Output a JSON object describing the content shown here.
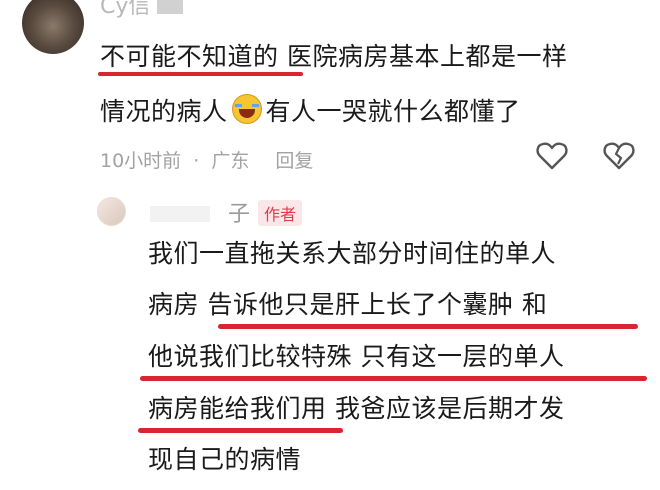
{
  "comment": {
    "username": "Cy信",
    "line1": "不可能不知道的 医院病房基本上都是一样",
    "line2_a": "情况的病人",
    "line2_b": "有人一哭就什么都懂了",
    "emoji_icon": "laughing-crying-emoji",
    "time": "10小时前",
    "dot": "·",
    "location": "广东",
    "reply_label": "回复"
  },
  "reply": {
    "username": "子",
    "author_badge": "作者",
    "lines": [
      "我们一直拖关系大部分时间住的单人",
      "病房  告诉他只是肝上长了个囊肿   和",
      "他说我们比较特殊  只有这一层的单人",
      "病房能给我们用   我爸应该是后期才发",
      "现自己的病情"
    ]
  },
  "colors": {
    "underline": "#d9252f",
    "meta_text": "#a2a2a2",
    "author_tag": "#e33b4c"
  }
}
